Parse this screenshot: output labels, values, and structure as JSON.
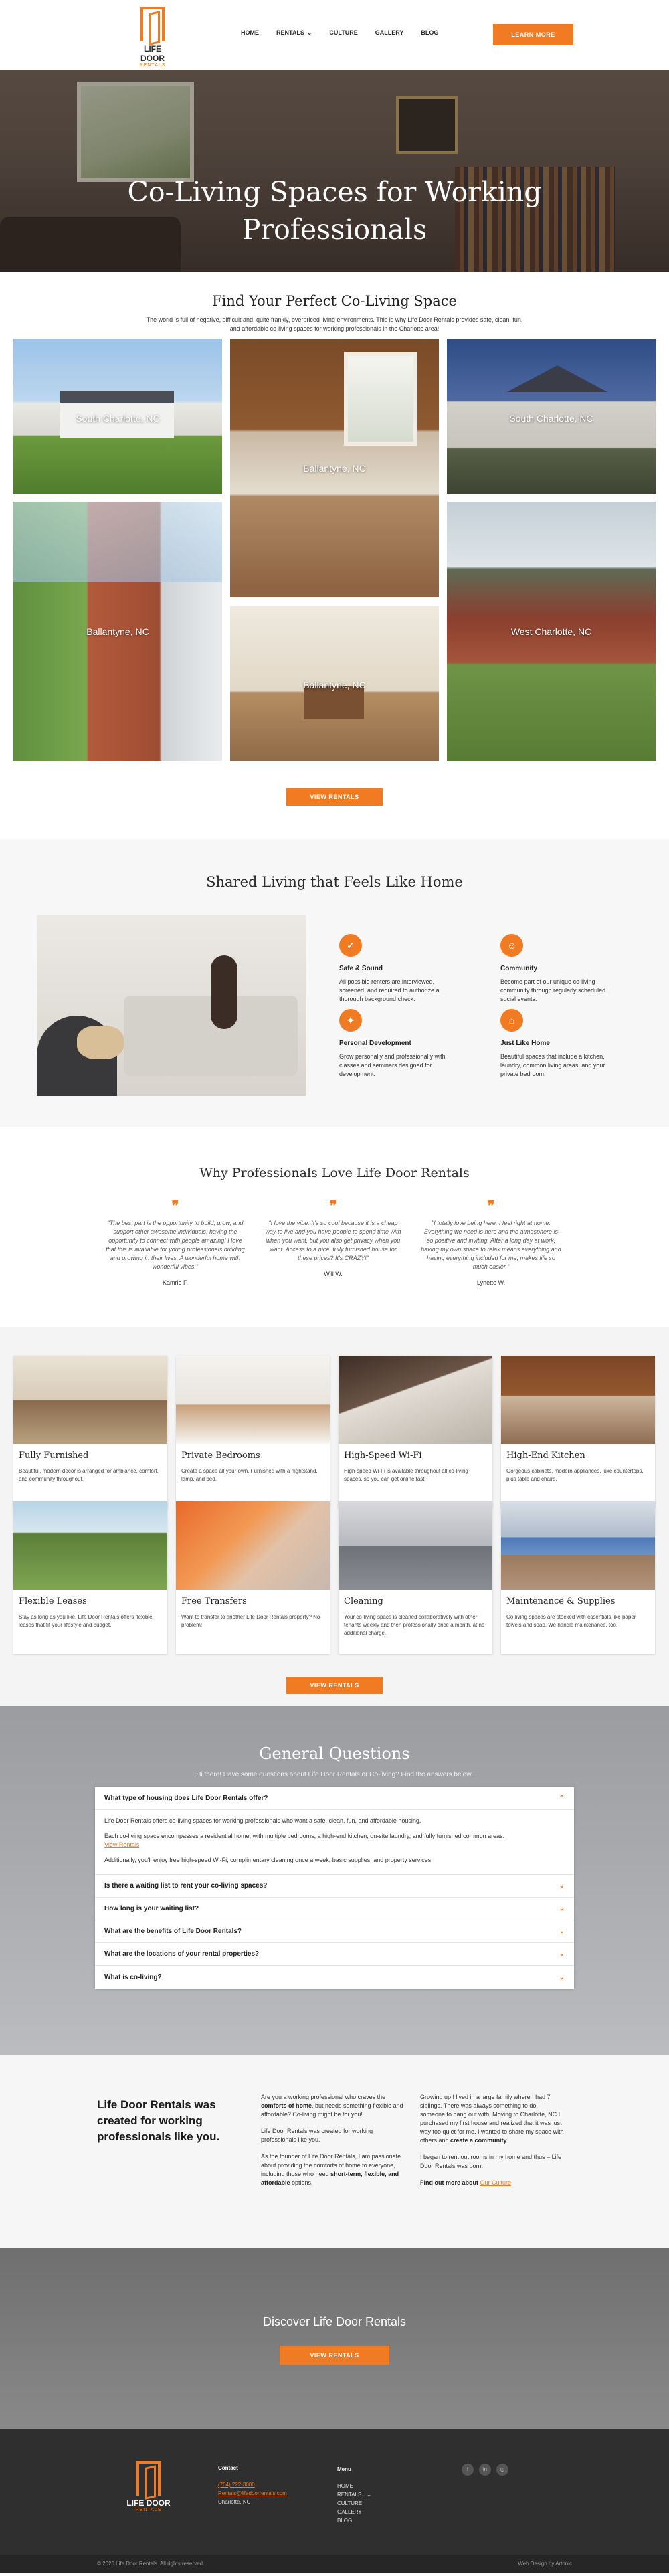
{
  "brand": {
    "name": "LIFE DOOR",
    "sub": "RENTALS",
    "accent": "#f07b22"
  },
  "nav": {
    "items": [
      "HOME",
      "RENTALS",
      "CULTURE",
      "GALLERY",
      "BLOG"
    ],
    "rentals_chevron": "⌄",
    "cta": "LEARN MORE"
  },
  "hero": {
    "title_line1": "Co-Living Spaces for Working",
    "title_line2": "Professionals"
  },
  "find": {
    "title": "Find Your Perfect Co-Living Space",
    "intro": "The world is full of negative, difficult and, quite frankly, overpriced living environments. This is why Life Door Rentals provides safe, clean, fun, and affordable co-living spaces for working professionals in the Charlotte area!",
    "tiles": [
      "South Charlotte, NC",
      "Ballantyne, NC",
      "South Charlotte, NC",
      "Ballantyne, NC",
      "Ballantyne, NC",
      "West Charlotte, NC"
    ],
    "cta": "VIEW RENTALS"
  },
  "shared": {
    "title": "Shared Living that Feels Like Home",
    "features": [
      {
        "icon": "✓",
        "title": "Safe & Sound",
        "text": "All possible renters are interviewed, screened, and required to authorize a thorough background check."
      },
      {
        "icon": "☺",
        "title": "Community",
        "text": "Become part of our unique co-living community through regularly scheduled social events."
      },
      {
        "icon": "✦",
        "title": "Personal Development",
        "text": "Grow personally and professionally with classes and seminars designed for development."
      },
      {
        "icon": "⌂",
        "title": "Just Like Home",
        "text": "Beautiful spaces that include a kitchen, laundry, common living areas, and your private bedroom."
      }
    ]
  },
  "testimonials": {
    "title": "Why Professionals Love Life Door Rentals",
    "quote_mark": "❞",
    "items": [
      {
        "text": "\"The best part is the opportunity to build, grow, and support other awesome individuals; having the opportunity to connect with people amazing! I love that this is available for young professionals building and growing in their lives. A wonderful home with wonderful vibes.\"",
        "name": "Kamrie F."
      },
      {
        "text": "\"I love the vibe. It's so cool because it is a cheap way to live and you have people to spend time with when you want, but you also get privacy when you want. Access to a nice, fully furnished house for these prices? It's CRAZY!\"",
        "name": "Will W."
      },
      {
        "text": "\"I totally love being here. I feel right at home. Everything we need is here and the atmosphere is so positive and inviting. After a long day at work, having my own space to relax means everything and having everything included for me, makes life so much easier.\"",
        "name": "Lynette W."
      }
    ]
  },
  "amenities": {
    "items": [
      {
        "title": "Fully Furnished",
        "text": "Beautiful, modern décor is arranged for ambiance, comfort, and community throughout."
      },
      {
        "title": "Private Bedrooms",
        "text": "Create a space all your own. Furnished with a nightstand, lamp, and bed."
      },
      {
        "title": "High-Speed Wi-Fi",
        "text": "High-speed Wi-Fi is available throughout all co-living spaces, so you can get online fast."
      },
      {
        "title": "High-End Kitchen",
        "text": "Gorgeous cabinets, modern appliances, luxe countertops, plus table and chairs."
      },
      {
        "title": "Flexible Leases",
        "text": "Stay as long as you like. Life Door Rentals offers flexible leases that fit your lifestyle and budget."
      },
      {
        "title": "Free Transfers",
        "text": "Want to transfer to another Life Door Rentals property? No problem!"
      },
      {
        "title": "Cleaning",
        "text": "Your co-living space is cleaned collaboratively with other tenants weekly and then professionally once a month, at no additional charge."
      },
      {
        "title": "Maintenance & Supplies",
        "text": "Co-living spaces are stocked with essentials like paper towels and soap. We handle maintenance, too."
      }
    ],
    "cta": "VIEW RENTALS"
  },
  "faq": {
    "title": "General Questions",
    "intro": "Hi there! Have some questions about Life Door Rentals or Co-living? Find the answers below.",
    "open_question": "What type of housing does Life Door Rentals offer?",
    "answer_p1": "Life Door Rentals offers co-living spaces for working professionals who want a safe, clean, fun, and affordable housing.",
    "answer_p2": "Each co-living space encompasses a residential home, with multiple bedrooms, a high-end kitchen, on-site laundry, and fully furnished common areas.",
    "answer_link": "View Rentals",
    "answer_p3": "Additionally, you'll enjoy free high-speed Wi-Fi, complimentary cleaning once a week, basic supplies, and property services.",
    "questions": [
      "Is there a waiting list to rent your co-living spaces?",
      "How long is your waiting list?",
      "What are the benefits of Life Door Rentals?",
      "What are the locations of your rental properties?",
      "What is co-living?"
    ],
    "chev_open": "⌃",
    "chev_closed": "⌄"
  },
  "created": {
    "heading": "Life Door Rentals was created for working professionals like you.",
    "col1_p1_a": "Are you a working professional who craves the ",
    "col1_p1_b": "comforts of home",
    "col1_p1_c": ", but needs something flexible and affordable? Co-living might be for you!",
    "col1_p2": "Life Door Rentals was created for working professionals like you.",
    "col1_p3_a": "As the founder of Life Door Rentals, I am passionate about providing the comforts of home to everyone, including those who need ",
    "col1_p3_b": "short-term, flexible, and affordable",
    "col1_p3_c": " options.",
    "col2_p1": "Growing up I lived in a large family where I had 7 siblings. There was always something to do, someone to hang out with. Moving to Charlotte, NC I purchased my first house and realized that it was just way too quiet for me. I wanted to share my space with others and ",
    "col2_p1_b": "create a community",
    "col2_p1_c": ".",
    "col2_p2": "I began to rent out rooms in my home and thus – Life Door Rentals was born.",
    "col2_p3_a": "Find out more about ",
    "col2_p3_link": "Our Culture"
  },
  "discover": {
    "title": "Discover Life Door Rentals",
    "cta": "VIEW RENTALS"
  },
  "footer": {
    "contact_heading": "Contact",
    "phone": "(704) 222-3000",
    "email": "Rentals@lifedoorrentals.com",
    "city": "Charlotte, NC",
    "menu_heading": "Menu",
    "menu": [
      "HOME",
      "RENTALS",
      "CULTURE",
      "GALLERY",
      "BLOG"
    ],
    "menu_chevron": "⌄",
    "social": [
      "f",
      "in",
      "◎"
    ],
    "copyright": "© 2020 Life Door Rentals. All rights reserved.",
    "credit": "Web Design by Artonic"
  }
}
